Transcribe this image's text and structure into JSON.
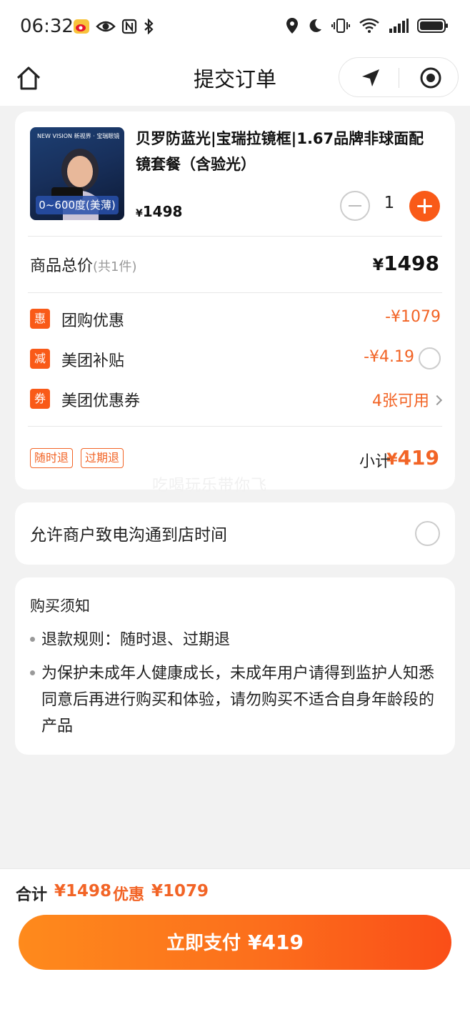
{
  "status_bar": {
    "time": "06:32"
  },
  "header": {
    "title": "提交订单"
  },
  "product": {
    "title": "贝罗防蓝光|宝瑞拉镜框|1.67品牌非球面配镜套餐（含验光）",
    "image_tag": "0~600度(美薄)",
    "image_logo_text": "NEW VISION 新视界 · 宝瑞眼镜",
    "currency": "¥",
    "price": "1498",
    "quantity": "1"
  },
  "summary": {
    "total_label": "商品总价",
    "total_count": "(共1件)",
    "total_value": "1498",
    "currency": "¥"
  },
  "discounts": [
    {
      "badge": "惠",
      "label": "团购优惠",
      "value": "-¥1079"
    },
    {
      "badge": "减",
      "label": "美团补贴",
      "value": "-¥4.19"
    },
    {
      "badge": "券",
      "label": "美团优惠券",
      "value": "4张可用"
    }
  ],
  "policy_tags": [
    "随时退",
    "过期退"
  ],
  "subtotal": {
    "label": "小计",
    "currency": "¥",
    "value": "419"
  },
  "watermark": "吃喝玩乐带你飞",
  "allow_call": {
    "label": "允许商户致电沟通到店时间"
  },
  "notice": {
    "title": "购买须知",
    "items": [
      "退款规则：随时退、过期退",
      "为保护未成年人健康成长，未成年用户请得到监护人知悉同意后再进行购买和体验，请勿购买不适合自身年龄段的产品"
    ]
  },
  "bottom": {
    "sum_label": "合计",
    "sum_value": "¥1498",
    "discount_label": "优惠",
    "discount_value": "¥1079",
    "pay_label": "立即支付",
    "pay_amount": "¥419"
  },
  "colors": {
    "accent": "#f95a18",
    "price_orange": "#f26426"
  }
}
